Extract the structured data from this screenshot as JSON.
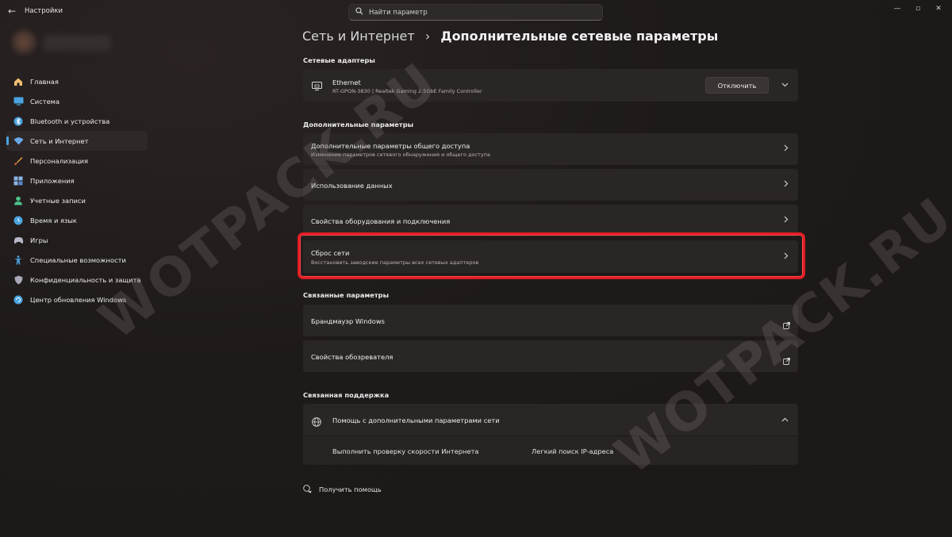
{
  "titlebar": {
    "back_icon": "arrow-left-icon",
    "title": "Настройки",
    "search_placeholder": "Найти параметр",
    "window_controls": [
      "minimize-icon",
      "maximize-icon",
      "close-icon"
    ]
  },
  "sidebar": {
    "items": [
      {
        "label": "Главная",
        "icon": "home-icon",
        "color": "#f0c070"
      },
      {
        "label": "Система",
        "icon": "monitor-icon",
        "color": "#4aa3df"
      },
      {
        "label": "Bluetooth и устройства",
        "icon": "bluetooth-icon",
        "color": "#4aa3df"
      },
      {
        "label": "Сеть и Интернет",
        "icon": "wifi-icon",
        "color": "#6aa9e8",
        "active": true
      },
      {
        "label": "Персонализация",
        "icon": "brush-icon",
        "color": "#e8a04a"
      },
      {
        "label": "Приложения",
        "icon": "apps-icon",
        "color": "#8ab4e8"
      },
      {
        "label": "Учетные записи",
        "icon": "person-icon",
        "color": "#4ac28a"
      },
      {
        "label": "Время и язык",
        "icon": "globe-clock-icon",
        "color": "#4aa3df"
      },
      {
        "label": "Игры",
        "icon": "gamepad-icon",
        "color": "#b8b8c8"
      },
      {
        "label": "Специальные возможности",
        "icon": "accessibility-icon",
        "color": "#4aa3df"
      },
      {
        "label": "Конфиденциальность и защита",
        "icon": "shield-icon",
        "color": "#a8a8b8"
      },
      {
        "label": "Центр обновления Windows",
        "icon": "update-icon",
        "color": "#4aa3df"
      }
    ]
  },
  "main": {
    "breadcrumb": {
      "parent": "Сеть и Интернет",
      "separator": "›",
      "current": "Дополнительные сетевые параметры"
    },
    "adapters": {
      "title": "Сетевые адаптеры",
      "items": [
        {
          "name": "Ethernet",
          "details": "RT-GPON-3830 | Realtek Gaming 2.5GbE Family Controller",
          "button": "Отключить",
          "icon": "ethernet-icon"
        }
      ]
    },
    "advanced": {
      "title": "Дополнительные параметры",
      "items": [
        {
          "title": "Дополнительные параметры общего доступа",
          "subtitle": "Изменение параметров сетевого обнаружения и общего доступа"
        },
        {
          "title": "Использование данных"
        },
        {
          "title": "Свойства оборудования и подключения"
        },
        {
          "title": "Сброс сети",
          "subtitle": "Восстановить заводские параметры всех сетевых адаптеров",
          "highlighted": true
        }
      ]
    },
    "related": {
      "title": "Связанные параметры",
      "items": [
        {
          "title": "Брандмауэр Windows",
          "icon": "open-external-icon"
        },
        {
          "title": "Свойства обозревателя",
          "icon": "open-external-icon"
        }
      ]
    },
    "support": {
      "title": "Связанная поддержка",
      "header": "Помощь с дополнительными параметрами сети",
      "links": [
        "Выполнить проверку скорости Интернета",
        "Легкий поиск IP-адреса"
      ]
    },
    "help": "Получить помощь"
  },
  "watermark": "WOTPACK.RU",
  "colors": {
    "accent": "#4aa3df",
    "highlight": "#e11d24",
    "card": "#2b2626",
    "background": "#1f1a1a"
  }
}
